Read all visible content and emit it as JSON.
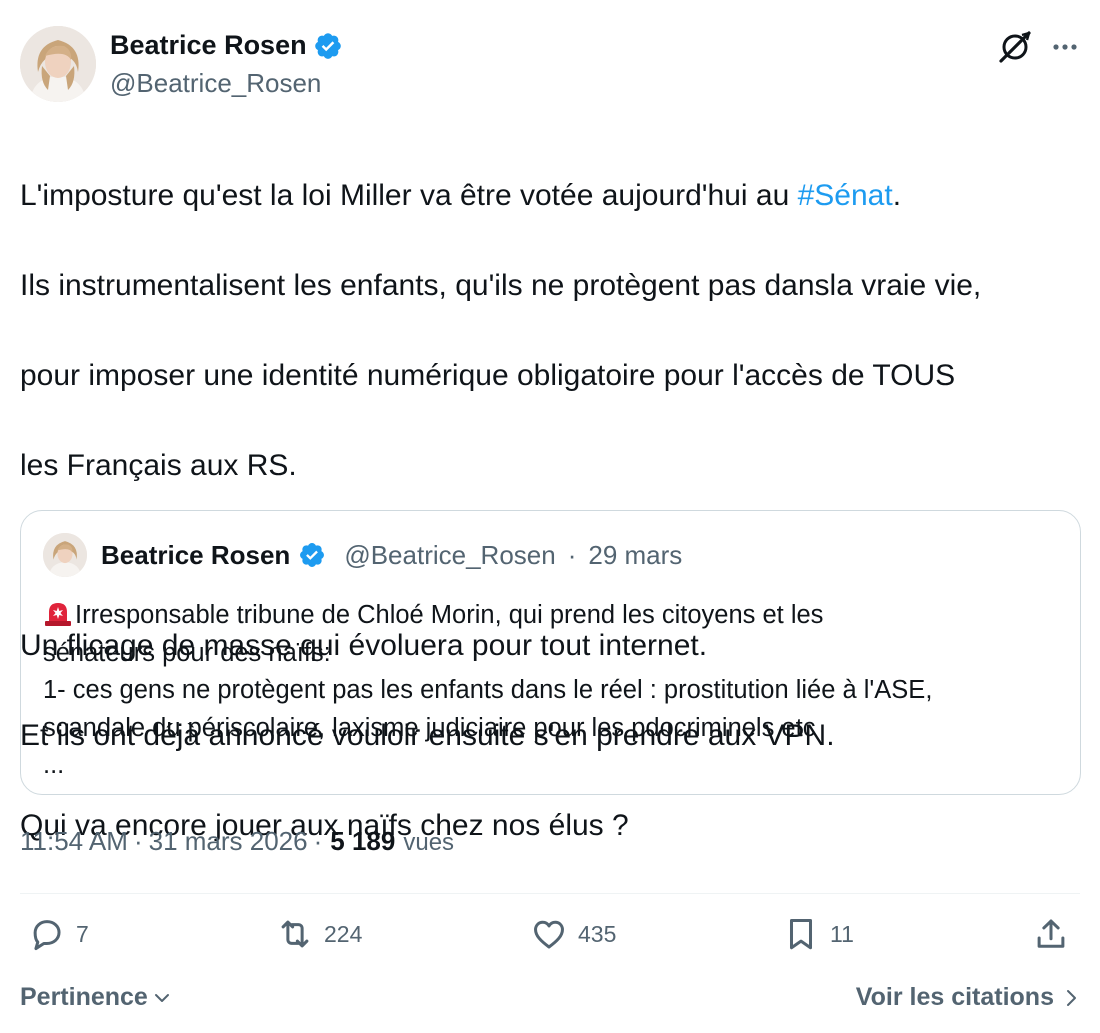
{
  "author": {
    "display_name": "Beatrice Rosen",
    "handle": "@Beatrice_Rosen",
    "verified": true
  },
  "icons": {
    "verified": "verified-badge-icon",
    "grok": "grok-icon",
    "more": "more-icon"
  },
  "tweet": {
    "lines": [
      {
        "before": "L'imposture qu'est la loi Miller va être votée aujourd'hui au ",
        "hashtag": "#Sénat",
        "after": "."
      },
      {
        "text": "Ils instrumentalisent les enfants, qu'ils ne protègent pas dansla vraie vie,"
      },
      {
        "text": "pour imposer une identité numérique obligatoire pour l'accès de TOUS"
      },
      {
        "text": "les Français aux RS."
      },
      {
        "text": ""
      },
      {
        "text": "Un flicage de masse qui évoluera pour tout internet."
      },
      {
        "text": "Et ils ont déjà annoncé vouloir ensuite s'en prendre aux VPN."
      },
      {
        "text": "Qui va encore jouer aux naïfs chez nos élus ?"
      }
    ]
  },
  "quoted": {
    "display_name": "Beatrice Rosen",
    "handle": "@Beatrice_Rosen",
    "separator": "·",
    "date": "29 mars",
    "lines": [
      "Irresponsable tribune de Chloé Morin, qui prend les citoyens et les",
      "sénateurs pour des naïfs:",
      "1- ces gens ne protègent pas les enfants dans le réel : prostitution liée à l'ASE,",
      "scandale du périscolaire, laxisme judiciaire pour les pdocriminels etc",
      "..."
    ],
    "emoji": "siren-icon"
  },
  "meta": {
    "time": "11:54 AM",
    "sep1": "·",
    "date": "31 mars 2026",
    "sep2": "·",
    "views_count": "5 189",
    "views_label": "vues"
  },
  "actions": {
    "replies": "7",
    "reposts": "224",
    "likes": "435",
    "bookmarks": "11"
  },
  "footer": {
    "sort_label": "Pertinence",
    "quotes_label": "Voir les citations"
  },
  "colors": {
    "accent": "#1d9bf0",
    "text": "#0f1419",
    "muted": "#536471",
    "border": "#cfd9de"
  }
}
